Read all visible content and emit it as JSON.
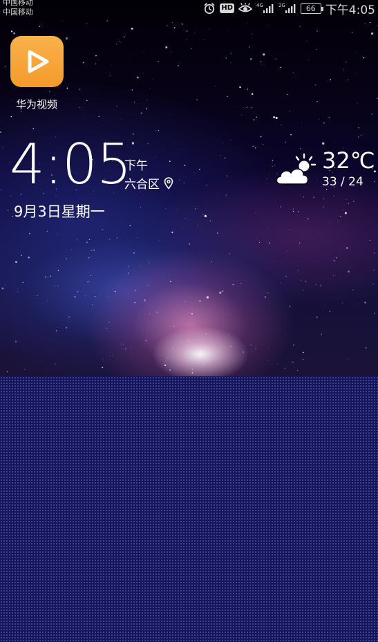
{
  "status_bar": {
    "carriers": [
      "中国移动",
      "中国移动"
    ],
    "icons": [
      "alarm-icon",
      "hd-badge",
      "eye-comfort-icon",
      "signal-4g-icon",
      "signal-2g-icon",
      "battery-icon"
    ],
    "hd_label": "HD",
    "net_labels": [
      "4G",
      "2G"
    ],
    "battery_level": "66",
    "time": "下午4:05"
  },
  "home": {
    "app": {
      "label": "华为视频",
      "icon": "play-icon",
      "color": "#f5a53a"
    }
  },
  "clock_widget": {
    "time": "4:05",
    "ampm": "下午",
    "location": "六合区",
    "location_icon": "location-pin-icon",
    "date": "9月3日星期一"
  },
  "weather_widget": {
    "icon": "partly-cloudy-icon",
    "temperature": "32℃",
    "range": "33 / 24"
  }
}
